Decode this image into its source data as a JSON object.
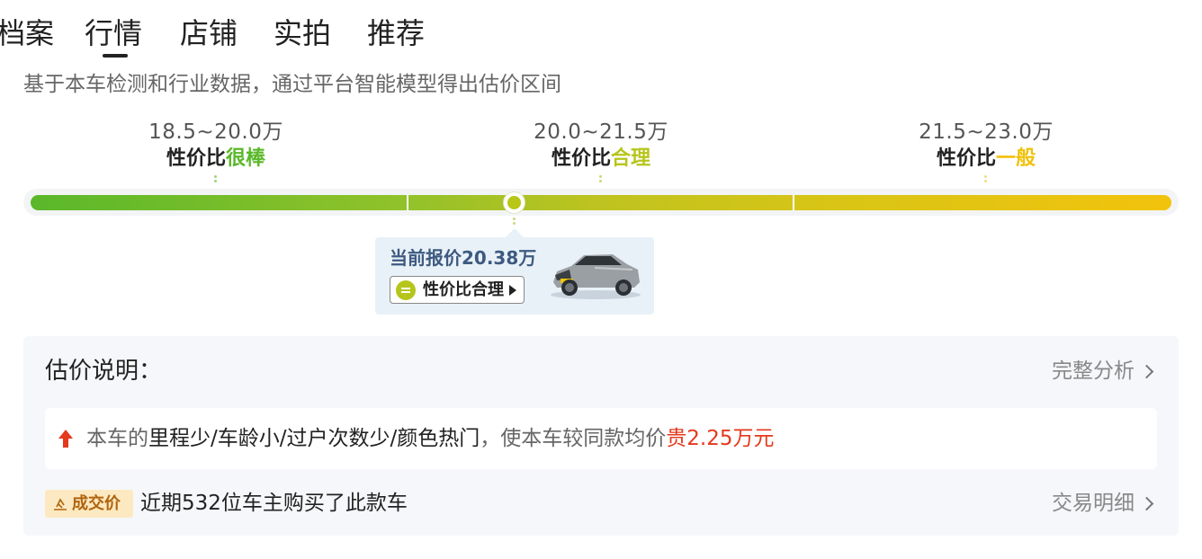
{
  "tabs": [
    {
      "label": "档案"
    },
    {
      "label": "行情",
      "active": true
    },
    {
      "label": "店铺"
    },
    {
      "label": "实拍"
    },
    {
      "label": "推荐"
    }
  ],
  "description": "基于本车检测和行业数据，通过平台智能模型得出估价区间",
  "ranges": [
    {
      "price": "18.5~20.0万",
      "rating_prefix": "性价比",
      "rating_word": "很棒",
      "color": "#5ab82a"
    },
    {
      "price": "20.0~21.5万",
      "rating_prefix": "性价比",
      "rating_word": "合理",
      "color": "#b6c51b"
    },
    {
      "price": "21.5~23.0万",
      "rating_prefix": "性价比",
      "rating_word": "一般",
      "color": "#f0c20c"
    }
  ],
  "current_price": {
    "value_fraction_on_scale": 0.425,
    "title": "当前报价20.38万",
    "badge": "性价比合理"
  },
  "explanation": {
    "title": "估价说明：",
    "full_analysis_link": "完整分析",
    "reason_prefix": "本车的",
    "reason_factors": "里程少/车龄小/过户次数少/颜色热门",
    "reason_middle": "，使本车较同款均价",
    "reason_highlight": "贵2.25万元"
  },
  "deal": {
    "tag": "成交价",
    "text": "近期532位车主购买了此款车",
    "link": "交易明细"
  },
  "colors": {
    "green": "#5ab82a",
    "olive": "#b6c51b",
    "yellow": "#f0c20c",
    "red": "#e4391b",
    "card_bg": "#e9f1f8"
  }
}
